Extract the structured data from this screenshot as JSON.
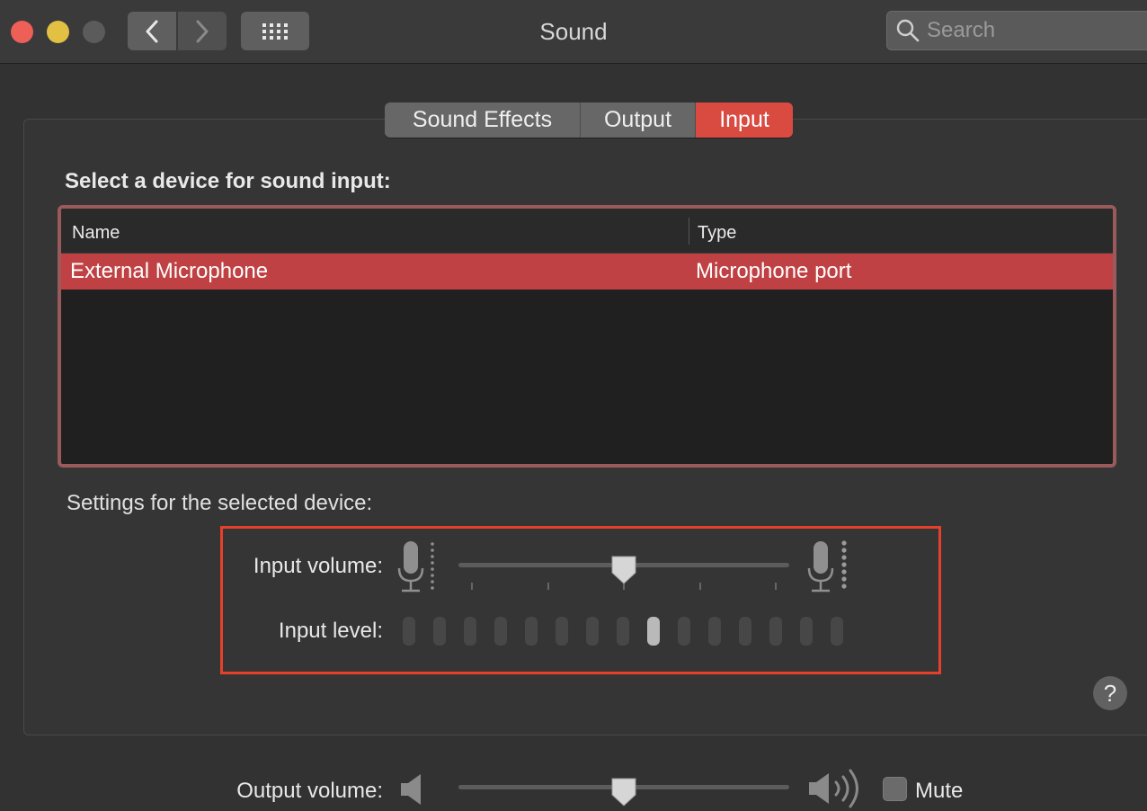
{
  "window": {
    "title": "Sound"
  },
  "search": {
    "placeholder": "Search"
  },
  "tabs": [
    {
      "label": "Sound Effects",
      "selected": false
    },
    {
      "label": "Output",
      "selected": false
    },
    {
      "label": "Input",
      "selected": true
    }
  ],
  "input_section": {
    "title": "Select a device for sound input:",
    "columns": [
      "Name",
      "Type"
    ],
    "rows": [
      {
        "name": "External Microphone",
        "type": "Microphone port",
        "selected": true
      }
    ]
  },
  "settings": {
    "title": "Settings for the selected device:",
    "input_volume_label": "Input volume:",
    "input_volume": 0.5,
    "input_level_label": "Input level:",
    "input_level_segments": 15,
    "input_level_active_index": 8
  },
  "help": {
    "label": "?"
  },
  "output": {
    "volume_label": "Output volume:",
    "volume": 0.5,
    "mute_label": "Mute",
    "muted": false
  },
  "colors": {
    "accent": "#d94a41",
    "selection": "#c04143",
    "highlight_border": "#e5402b"
  }
}
